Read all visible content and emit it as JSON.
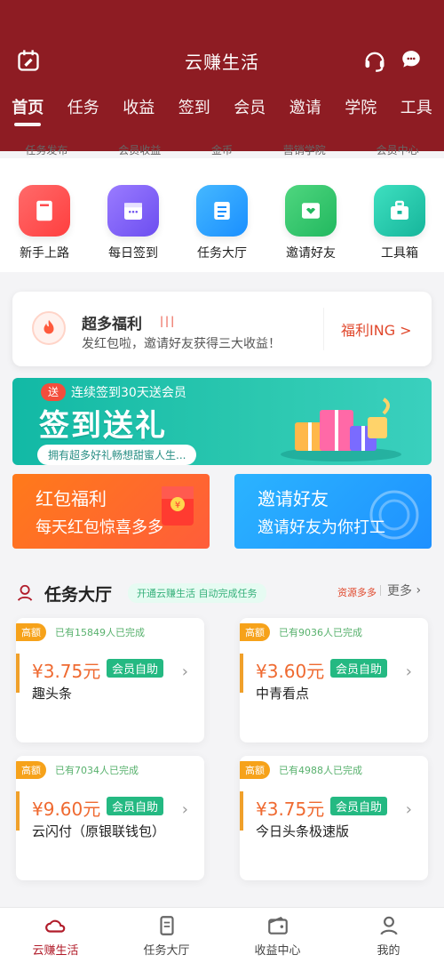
{
  "app": {
    "title": "云赚生活"
  },
  "nav": {
    "tabs": [
      "首页",
      "任务",
      "收益",
      "签到",
      "会员",
      "邀请",
      "学院",
      "工具"
    ],
    "active_index": 0
  },
  "ghost_labels": [
    "任务发布",
    "会员收益",
    "金币",
    "营销学院",
    "会员中心"
  ],
  "quick_icons": [
    {
      "label": "新手上路",
      "icon": "book-icon",
      "color": "#ff4d4f"
    },
    {
      "label": "每日签到",
      "icon": "calendar-icon",
      "color": "#7a5cf5"
    },
    {
      "label": "任务大厅",
      "icon": "list-icon",
      "color": "#16a2ff"
    },
    {
      "label": "邀请好友",
      "icon": "invite-icon",
      "color": "#2bc56c"
    },
    {
      "label": "工具箱",
      "icon": "toolbox-icon",
      "color": "#22c7a6"
    }
  ],
  "welfare": {
    "title": "超多福利",
    "subtitle": "发红包啦，邀请好友获得三大收益！",
    "link": "福利ING >"
  },
  "sign_banner": {
    "badge": "送",
    "top": "连续签到30天送会员",
    "main": "签到送礼",
    "sub": "拥有超多好礼畅想甜蜜人生..."
  },
  "cards": {
    "left": {
      "title": "红包福利",
      "subtitle": "每天红包惊喜多多"
    },
    "right": {
      "title": "邀请好友",
      "subtitle": "邀请好友为你打工"
    }
  },
  "task_section": {
    "title": "任务大厅",
    "pill": "开通云赚生活 自动完成任务",
    "more_left": "资源多多",
    "more": "更多"
  },
  "tasks": [
    {
      "tag": "高额",
      "completed": "已有15849人已完成",
      "price": "¥3.75元",
      "vip": "会员自助",
      "name": "趣头条"
    },
    {
      "tag": "高额",
      "completed": "已有9036人已完成",
      "price": "¥3.60元",
      "vip": "会员自助",
      "name": "中青看点"
    },
    {
      "tag": "高额",
      "completed": "已有7034人已完成",
      "price": "¥9.60元",
      "vip": "会员自助",
      "name": "云闪付（原银联钱包）"
    },
    {
      "tag": "高额",
      "completed": "已有4988人已完成",
      "price": "¥3.75元",
      "vip": "会员自助",
      "name": "今日头条极速版"
    }
  ],
  "bottom_nav": [
    {
      "label": "云赚生活",
      "icon": "cloud-icon",
      "active": true
    },
    {
      "label": "任务大厅",
      "icon": "document-icon",
      "active": false
    },
    {
      "label": "收益中心",
      "icon": "wallet-icon",
      "active": false
    },
    {
      "label": "我的",
      "icon": "user-icon",
      "active": false
    }
  ]
}
